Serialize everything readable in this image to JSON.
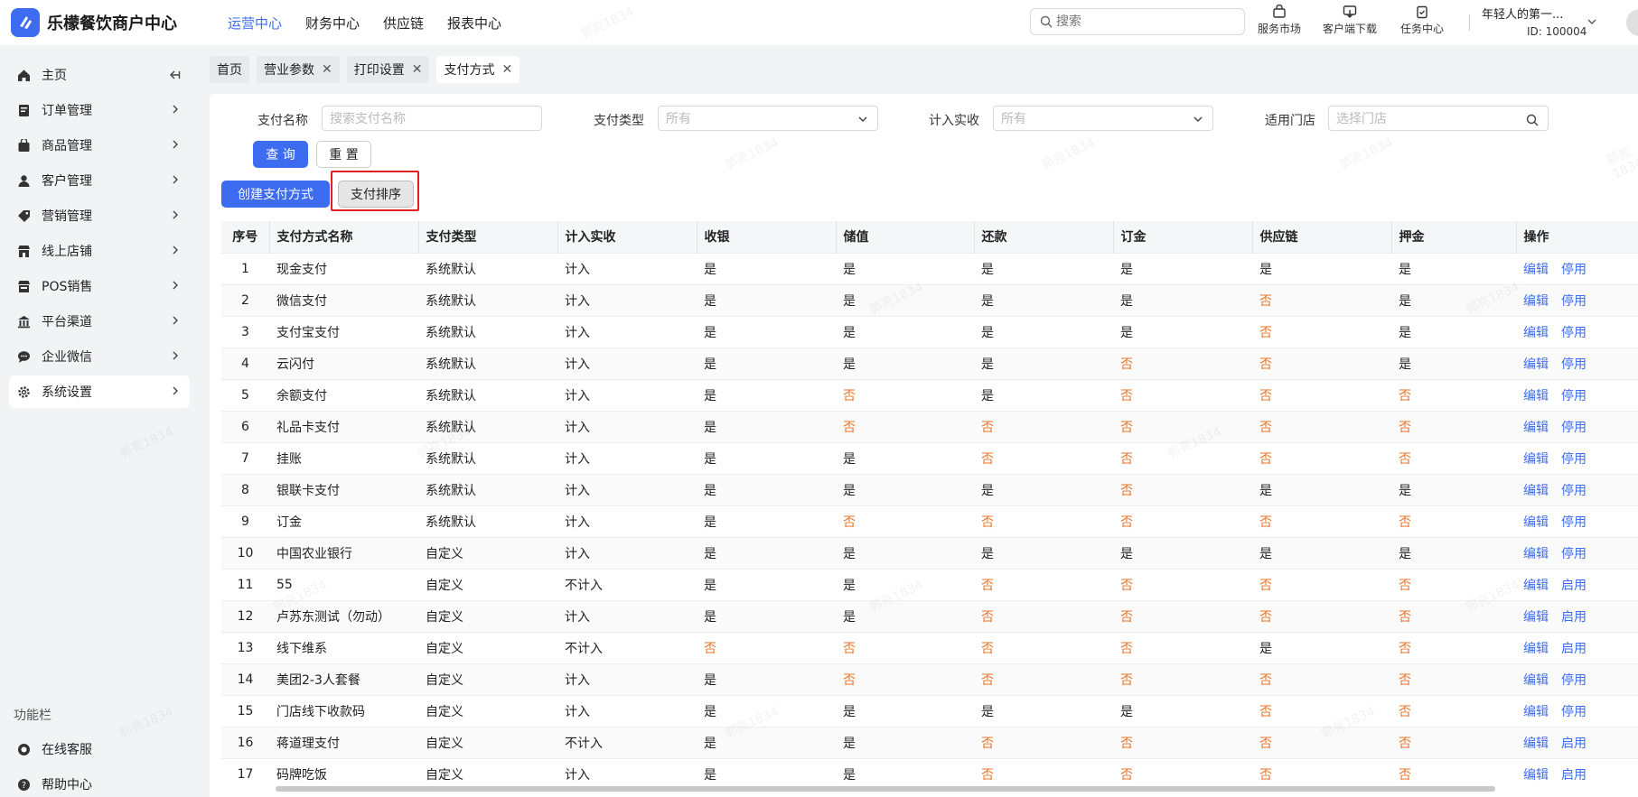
{
  "app": {
    "title": "乐檬餐饮商户中心"
  },
  "topnav": [
    {
      "label": "运营中心",
      "active": true
    },
    {
      "label": "财务中心",
      "active": false
    },
    {
      "label": "供应链",
      "active": false
    },
    {
      "label": "报表中心",
      "active": false
    }
  ],
  "search": {
    "placeholder": "搜索"
  },
  "tools": {
    "market": "服务市场",
    "download": "客户端下载",
    "task": "任务中心"
  },
  "user": {
    "name": "年轻人的第一...",
    "id": "ID: 100004"
  },
  "sidebar": {
    "items": [
      {
        "label": "主页",
        "icon": "home-icon"
      },
      {
        "label": "订单管理",
        "icon": "order-icon"
      },
      {
        "label": "商品管理",
        "icon": "goods-icon"
      },
      {
        "label": "客户管理",
        "icon": "user-icon"
      },
      {
        "label": "营销管理",
        "icon": "tag-icon"
      },
      {
        "label": "线上店铺",
        "icon": "shop-icon"
      },
      {
        "label": "POS销售",
        "icon": "pos-icon"
      },
      {
        "label": "平台渠道",
        "icon": "bank-icon"
      },
      {
        "label": "企业微信",
        "icon": "chat-icon"
      },
      {
        "label": "系统设置",
        "icon": "gear-icon"
      }
    ],
    "func_title": "功能栏",
    "service": "在线客服",
    "help": "帮助中心"
  },
  "tabs": [
    {
      "label": "首页",
      "closable": false
    },
    {
      "label": "营业参数",
      "closable": true
    },
    {
      "label": "打印设置",
      "closable": true
    },
    {
      "label": "支付方式",
      "closable": true
    }
  ],
  "filters": {
    "name_label": "支付名称",
    "name_placeholder": "搜索支付名称",
    "type_label": "支付类型",
    "type_value": "所有",
    "income_label": "计入实收",
    "income_value": "所有",
    "store_label": "适用门店",
    "store_placeholder": "选择门店",
    "query": "查 询",
    "reset": "重 置"
  },
  "actions": {
    "create": "创建支付方式",
    "sort": "支付排序"
  },
  "table": {
    "headers": [
      "序号",
      "支付方式名称",
      "支付类型",
      "计入实收",
      "收银",
      "储值",
      "还款",
      "订金",
      "供应链",
      "押金",
      "操作"
    ],
    "edit": "编辑",
    "rows": [
      [
        "1",
        "现金支付",
        "系统默认",
        "计入",
        "是",
        "是",
        "是",
        "是",
        "是",
        "是",
        "停用"
      ],
      [
        "2",
        "微信支付",
        "系统默认",
        "计入",
        "是",
        "是",
        "是",
        "是",
        "否",
        "是",
        "停用"
      ],
      [
        "3",
        "支付宝支付",
        "系统默认",
        "计入",
        "是",
        "是",
        "是",
        "是",
        "否",
        "是",
        "停用"
      ],
      [
        "4",
        "云闪付",
        "系统默认",
        "计入",
        "是",
        "是",
        "是",
        "否",
        "否",
        "是",
        "停用"
      ],
      [
        "5",
        "余额支付",
        "系统默认",
        "计入",
        "是",
        "否",
        "是",
        "否",
        "否",
        "否",
        "停用"
      ],
      [
        "6",
        "礼品卡支付",
        "系统默认",
        "计入",
        "是",
        "否",
        "否",
        "否",
        "否",
        "否",
        "停用"
      ],
      [
        "7",
        "挂账",
        "系统默认",
        "计入",
        "是",
        "是",
        "否",
        "否",
        "否",
        "否",
        "停用"
      ],
      [
        "8",
        "银联卡支付",
        "系统默认",
        "计入",
        "是",
        "是",
        "是",
        "否",
        "是",
        "是",
        "停用"
      ],
      [
        "9",
        "订金",
        "系统默认",
        "计入",
        "是",
        "否",
        "否",
        "否",
        "否",
        "否",
        "停用"
      ],
      [
        "10",
        "中国农业银行",
        "自定义",
        "计入",
        "是",
        "是",
        "是",
        "是",
        "是",
        "是",
        "停用"
      ],
      [
        "11",
        "55",
        "自定义",
        "不计入",
        "是",
        "是",
        "否",
        "否",
        "否",
        "否",
        "启用"
      ],
      [
        "12",
        "卢苏东测试（勿动）",
        "自定义",
        "计入",
        "是",
        "是",
        "否",
        "否",
        "否",
        "否",
        "启用"
      ],
      [
        "13",
        "线下维系",
        "自定义",
        "不计入",
        "否",
        "否",
        "否",
        "否",
        "是",
        "否",
        "启用"
      ],
      [
        "14",
        "美团2-3人套餐",
        "自定义",
        "计入",
        "是",
        "否",
        "否",
        "否",
        "否",
        "否",
        "停用"
      ],
      [
        "15",
        "门店线下收款码",
        "自定义",
        "计入",
        "是",
        "是",
        "是",
        "是",
        "否",
        "否",
        "停用"
      ],
      [
        "16",
        "蒋道理支付",
        "自定义",
        "不计入",
        "是",
        "是",
        "否",
        "否",
        "否",
        "否",
        "启用"
      ],
      [
        "17",
        "码牌吃饭",
        "自定义",
        "计入",
        "是",
        "是",
        "否",
        "否",
        "否",
        "否",
        "启用"
      ]
    ]
  },
  "watermark": "郭亮1834",
  "colors": {
    "accent": "#3d6cf0",
    "no": "#e8752a",
    "highlight": "#e02020"
  }
}
